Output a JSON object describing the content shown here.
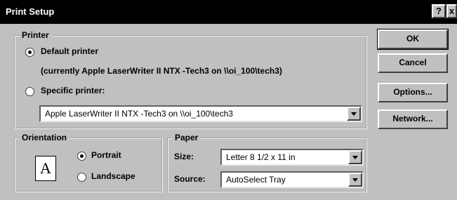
{
  "window": {
    "title": "Print Setup",
    "help_glyph": "?",
    "close_glyph": "x"
  },
  "printer": {
    "group_label": "Printer",
    "default_label": "Default printer",
    "default_checked": true,
    "current_text": "(currently Apple LaserWriter II NTX -Tech3 on \\\\oi_100\\tech3)",
    "specific_label": "Specific printer:",
    "specific_checked": false,
    "specific_value": "Apple LaserWriter II NTX -Tech3 on \\\\oi_100\\tech3"
  },
  "orientation": {
    "group_label": "Orientation",
    "icon_letter": "A",
    "portrait_label": "Portrait",
    "portrait_checked": true,
    "landscape_label": "Landscape",
    "landscape_checked": false
  },
  "paper": {
    "group_label": "Paper",
    "size_label": "Size:",
    "size_value": "Letter 8 1/2 x 11 in",
    "source_label": "Source:",
    "source_value": "AutoSelect Tray"
  },
  "buttons": {
    "ok": "OK",
    "cancel": "Cancel",
    "options": "Options...",
    "network": "Network..."
  }
}
